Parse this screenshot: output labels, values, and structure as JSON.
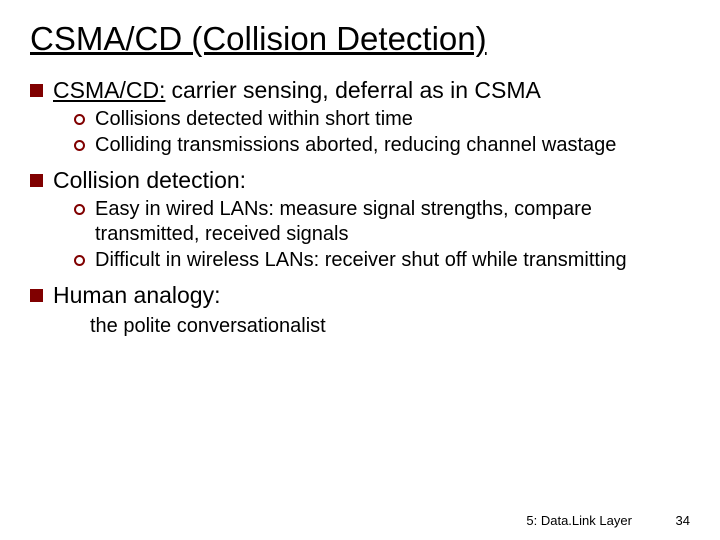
{
  "title": "CSMA/CD (Collision Detection)",
  "sections": [
    {
      "lead": "CSMA/CD:",
      "rest": "carrier sensing, deferral as in CSMA",
      "sub": [
        "Collisions detected within short time",
        "Colliding transmissions aborted, reducing channel wastage"
      ]
    },
    {
      "lead": "",
      "rest": "Collision detection:",
      "sub": [
        "Easy in wired LANs: measure signal strengths, compare transmitted, received signals",
        "Difficult in wireless LANs: receiver shut off while transmitting"
      ]
    },
    {
      "lead": "",
      "rest": "Human analogy:",
      "plain": "the polite conversationalist"
    }
  ],
  "footer": {
    "label": "5: Data.Link Layer",
    "page": "34"
  }
}
